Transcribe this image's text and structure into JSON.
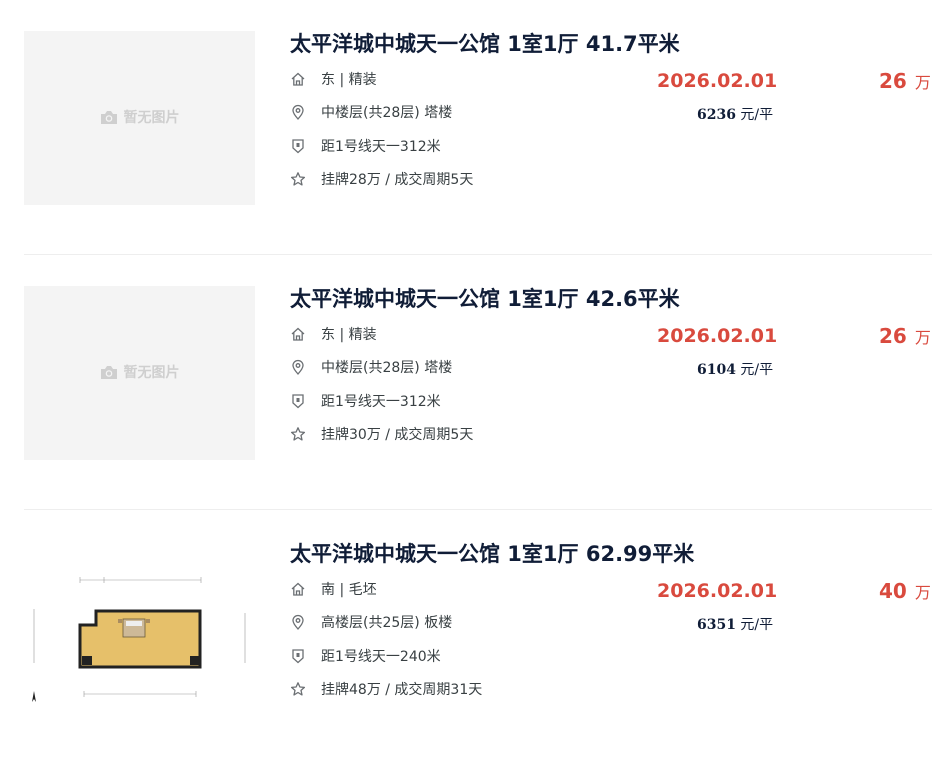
{
  "listings": [
    {
      "title": "太平洋城中城天一公馆 1室1厅 41.7平米",
      "no_image_label": "暂无图片",
      "orientation_decoration": "东 | 精装",
      "floor_info": "中楼层(共28层) 塔楼",
      "subway_info": "距1号线天一312米",
      "listing_info": "挂牌28万 / 成交周期5天",
      "deal_date": "2026.02.01",
      "unit_price_value": "6236",
      "unit_price_unit": "元/平",
      "total_price_value": "26",
      "total_price_unit": "万",
      "has_floorplan": false
    },
    {
      "title": "太平洋城中城天一公馆 1室1厅 42.6平米",
      "no_image_label": "暂无图片",
      "orientation_decoration": "东 | 精装",
      "floor_info": "中楼层(共28层) 塔楼",
      "subway_info": "距1号线天一312米",
      "listing_info": "挂牌30万 / 成交周期5天",
      "deal_date": "2026.02.01",
      "unit_price_value": "6104",
      "unit_price_unit": "元/平",
      "total_price_value": "26",
      "total_price_unit": "万",
      "has_floorplan": false
    },
    {
      "title": "太平洋城中城天一公馆 1室1厅 62.99平米",
      "no_image_label": "",
      "orientation_decoration": "南 | 毛坯",
      "floor_info": "高楼层(共25层) 板楼",
      "subway_info": "距1号线天一240米",
      "listing_info": "挂牌48万 / 成交周期31天",
      "deal_date": "2026.02.01",
      "unit_price_value": "6351",
      "unit_price_unit": "元/平",
      "total_price_value": "40",
      "total_price_unit": "万",
      "has_floorplan": true
    }
  ],
  "icons": {
    "house": "house-icon",
    "location": "location-pin-icon",
    "subway": "shield-icon",
    "listing": "star-icon",
    "camera": "camera-icon"
  },
  "colors": {
    "title": "#101d37",
    "price_red": "#d94a3e",
    "text": "#394043",
    "placeholder_bg": "#f4f4f4",
    "divider": "#eeeeee"
  }
}
